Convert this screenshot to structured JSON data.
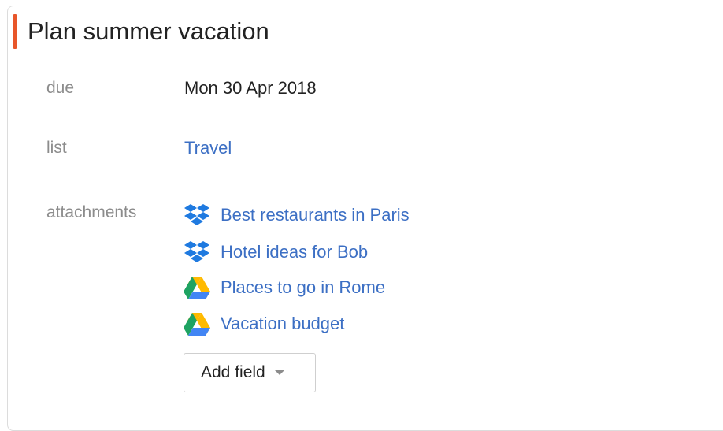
{
  "task": {
    "title": "Plan summer vacation",
    "priority_color": "#e8562a"
  },
  "fields": {
    "due": {
      "label": "due",
      "value": "Mon 30 Apr 2018"
    },
    "list": {
      "label": "list",
      "value": "Travel"
    },
    "attachments": {
      "label": "attachments",
      "items": [
        {
          "name": "Best restaurants in Paris",
          "icon": "dropbox-icon"
        },
        {
          "name": "Hotel ideas for Bob",
          "icon": "dropbox-icon"
        },
        {
          "name": "Places to go in Rome",
          "icon": "google-drive-icon"
        },
        {
          "name": "Vacation budget",
          "icon": "google-drive-icon"
        }
      ]
    }
  },
  "add_field": {
    "label": "Add field"
  },
  "colors": {
    "link": "#3c6fc4",
    "label": "#8c8c8c",
    "dropbox": "#1f7ae0",
    "drive_green": "#1ea362",
    "drive_yellow": "#ffba00",
    "drive_blue": "#4285f4"
  }
}
